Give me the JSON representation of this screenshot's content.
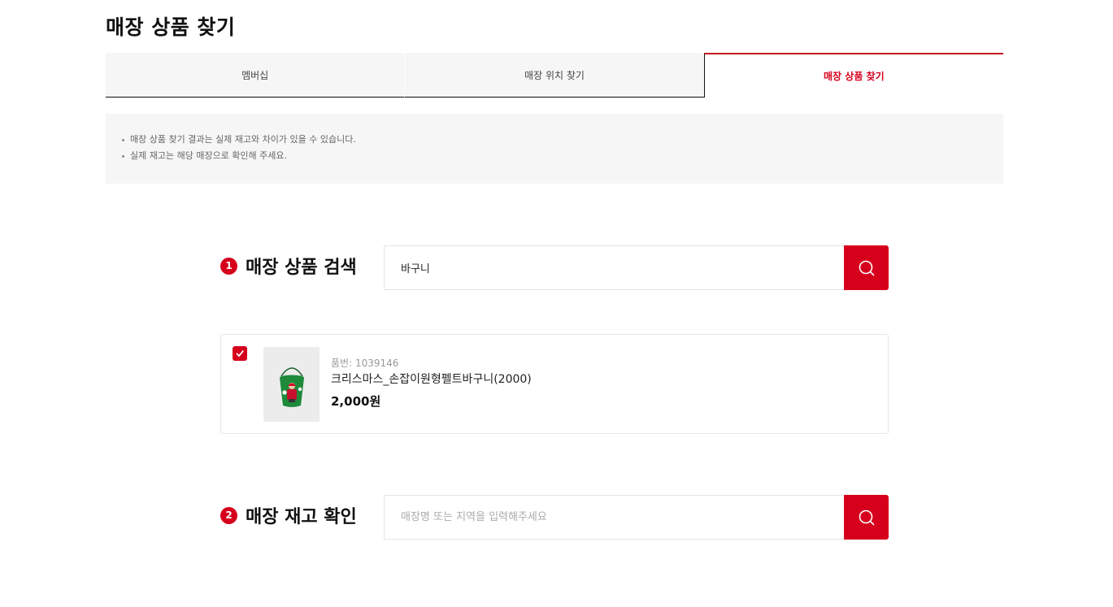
{
  "page": {
    "title": "매장 상품 찾기"
  },
  "tabs": [
    {
      "label": "멤버십",
      "active": false
    },
    {
      "label": "매장 위치 찾기",
      "active": false
    },
    {
      "label": "매장 상품 찾기",
      "active": true
    }
  ],
  "notice": [
    "매장 상품 찾기 결과는 실제 재고와 차이가 있을 수 있습니다.",
    "실제 재고는 해당 매장으로 확인해 주세요."
  ],
  "step1": {
    "num": "1",
    "label": "매장 상품 검색",
    "input_value": "바구니"
  },
  "product": {
    "checked": true,
    "code": "품번: 1039146",
    "name": "크리스마스_손잡이원형펠트바구니(2000)",
    "price": "2,000원"
  },
  "step2": {
    "num": "2",
    "label": "매장 재고 확인",
    "placeholder": "매장명 또는 지역을 입력해주세요"
  },
  "colors": {
    "accent": "#d6001c",
    "notice_bg": "#f6f6f6"
  },
  "icons": {
    "search": "search-icon",
    "check": "check-icon"
  }
}
